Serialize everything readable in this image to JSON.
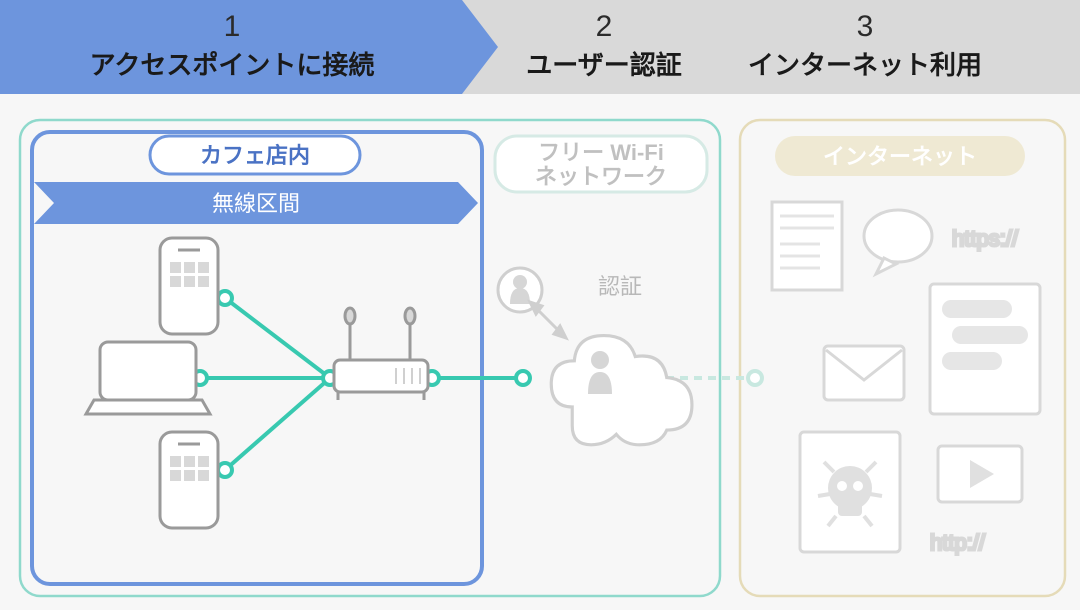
{
  "steps": {
    "s1": {
      "num": "1",
      "label": "アクセスポイントに接続"
    },
    "s2": {
      "num": "2",
      "label": "ユーザー認証"
    },
    "s3": {
      "num": "3",
      "label": "インターネット利用"
    }
  },
  "zones": {
    "cafe": "カフェ店内",
    "wireless": "無線区間",
    "wifi_net_l1": "フリー Wi-Fi",
    "wifi_net_l2": "ネットワーク",
    "internet": "インターネット",
    "auth": "認証"
  },
  "urls": {
    "https": "https://",
    "http": "http://"
  },
  "colors": {
    "accent_blue": "#6d95dd",
    "teal": "#38c9b0",
    "light_gray": "#d9d9d9",
    "faded": "#c8c8c8",
    "beige": "#e5dbb8"
  }
}
